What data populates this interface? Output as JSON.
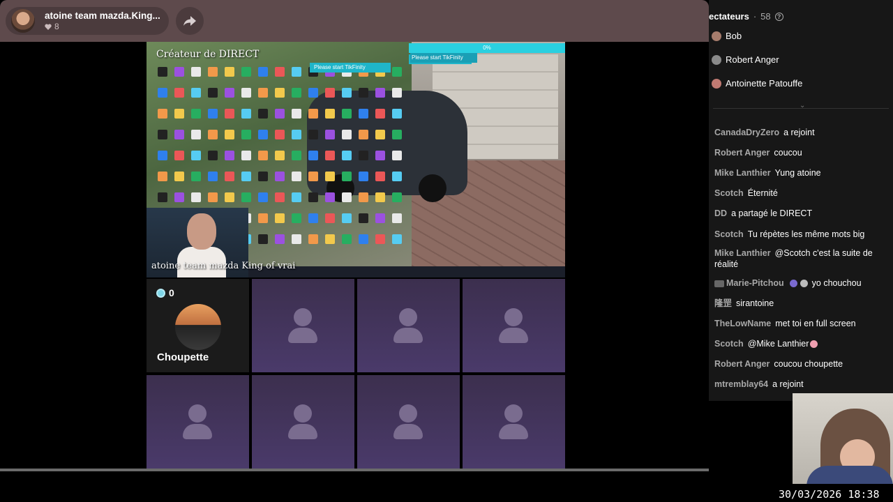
{
  "header": {
    "host_name": "atoine team mazda.King...",
    "likes": "8"
  },
  "stream": {
    "creator_label": "Créateur de DIRECT",
    "streamer_caption": "atoine team mazda King of vrai",
    "tiktok_banner_1": "Please start TikFinity",
    "tiktok_banner_2": "Please start TikFinity",
    "progress_a": "0%",
    "progress_b": "0%"
  },
  "guests": {
    "active": {
      "name": "Choupette",
      "coins": "0"
    },
    "empty_count": 7
  },
  "viewers": {
    "title": "ectateurs",
    "count": "58",
    "list": [
      "Bob",
      "Robert Anger",
      "Antoinette Patouffe"
    ]
  },
  "chat": [
    {
      "user": "CanadaDryZero",
      "msg": "a rejoint"
    },
    {
      "user": "Robert Anger",
      "msg": "coucou"
    },
    {
      "user": "Mike Lanthier",
      "msg": "Yung atoine"
    },
    {
      "user": "Scotch",
      "msg": "Éternité"
    },
    {
      "user": "DD",
      "msg": "a partagé le DIRECT"
    },
    {
      "user": "Scotch",
      "msg": "Tu répètes les même mots big"
    },
    {
      "user": "Mike Lanthier",
      "msg": "@Scotch c'est la suite de réalité"
    },
    {
      "user": "Marie-Pitchou",
      "msg": "yo chouchou"
    },
    {
      "user": "隆罡",
      "msg": "sirantoine"
    },
    {
      "user": "TheLowName",
      "msg": "met toi en full screen"
    },
    {
      "user": "Scotch",
      "msg": "@Mike Lanthier"
    },
    {
      "user": "Robert Anger",
      "msg": "coucou choupette"
    },
    {
      "user": "mtremblay64",
      "msg": "a rejoint"
    }
  ],
  "timestamp": "30/03/2026 18:38",
  "colors": {
    "topbar": "#5e4a4c",
    "guest_tile": "#4a3a6a",
    "panel": "#171717",
    "accent_cyan": "#2ad0e0"
  },
  "icons": {
    "share": "share-arrow-icon",
    "heart": "heart-icon",
    "help": "question-circle-icon",
    "coin": "coin-icon",
    "chevron": "chevron-down-icon"
  }
}
